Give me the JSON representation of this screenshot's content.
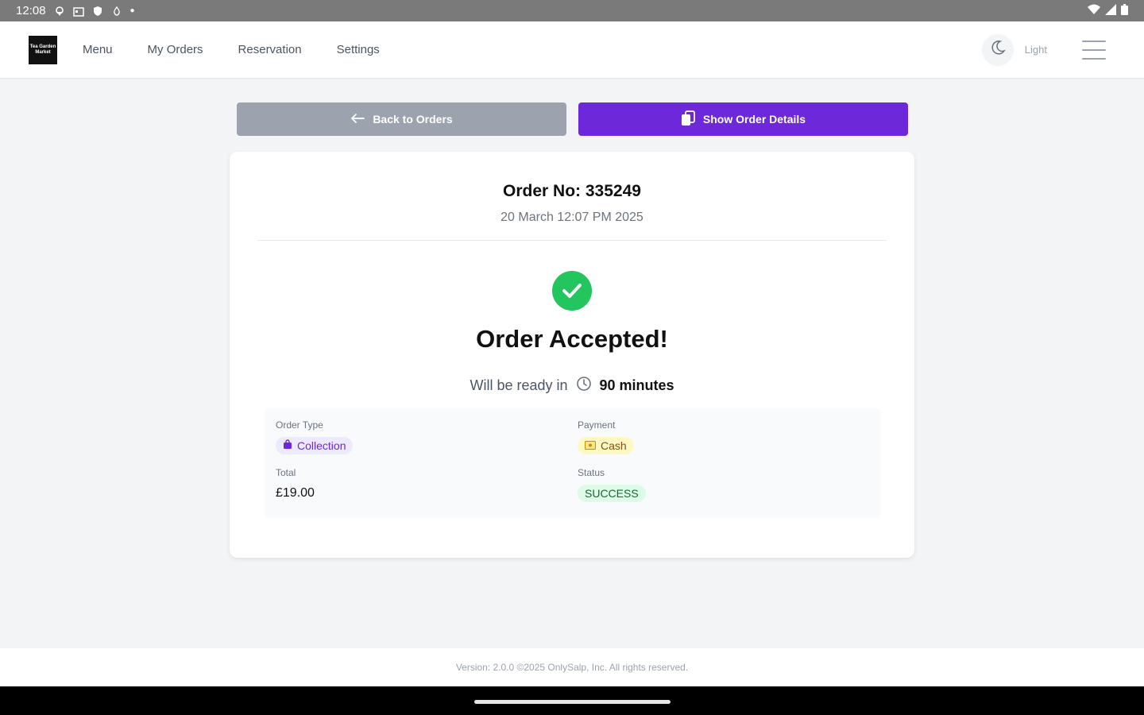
{
  "status_bar": {
    "time": "12:08"
  },
  "nav": {
    "logo_text": "Tea Garden Market",
    "links": [
      "Menu",
      "My Orders",
      "Reservation",
      "Settings"
    ],
    "theme_label": "Light"
  },
  "actions": {
    "back_label": "Back to Orders",
    "details_label": "Show Order Details"
  },
  "order": {
    "number": "Order No: 335249",
    "date": "20 March 12:07 PM 2025",
    "headline": "Order Accepted!",
    "ready_prefix": "Will be ready in",
    "ready_time": "90 minutes",
    "order_type_label": "Order Type",
    "order_type": "Collection",
    "payment_label": "Payment",
    "payment": "Cash",
    "total_label": "Total",
    "total": "£19.00",
    "status_label": "Status",
    "status": "SUCCESS"
  },
  "footer": {
    "text": "Version: 2.0.0 ©2025 OnlySalp, Inc. All rights reserved."
  },
  "colors": {
    "accent": "#6d28d9",
    "success": "#22c55e",
    "back_button": "#9ca3af"
  }
}
